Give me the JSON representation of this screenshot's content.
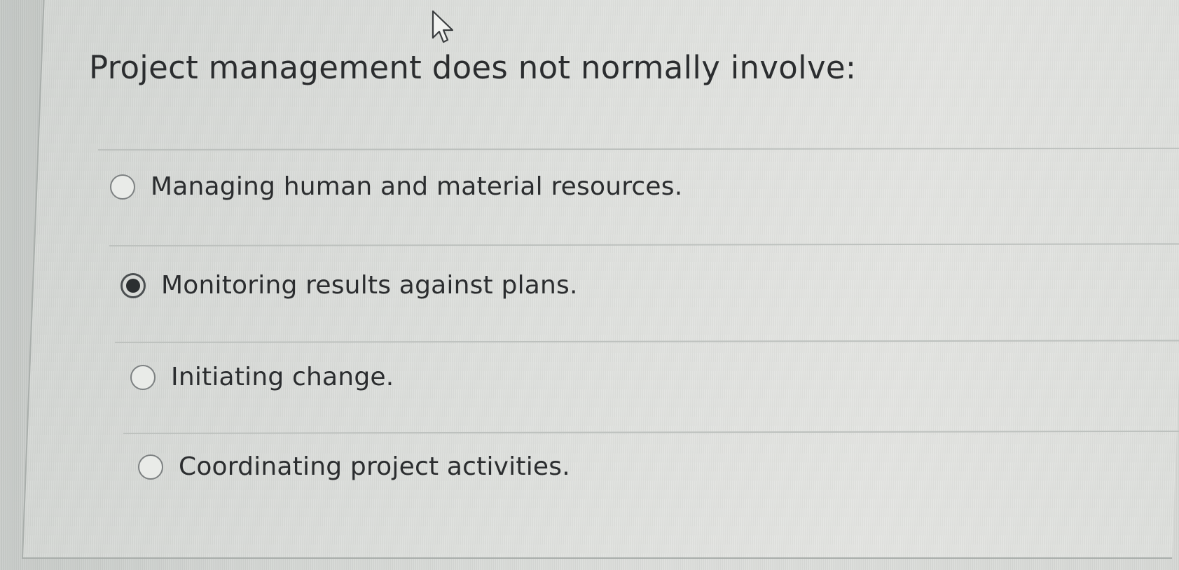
{
  "question": {
    "title": "Project management does not normally involve:"
  },
  "options": [
    {
      "label": "Managing human and material resources.",
      "selected": false
    },
    {
      "label": "Monitoring results against plans.",
      "selected": true
    },
    {
      "label": "Initiating change.",
      "selected": false
    },
    {
      "label": "Coordinating project activities.",
      "selected": false
    }
  ],
  "cursor": {
    "icon": "mouse-pointer-icon"
  }
}
